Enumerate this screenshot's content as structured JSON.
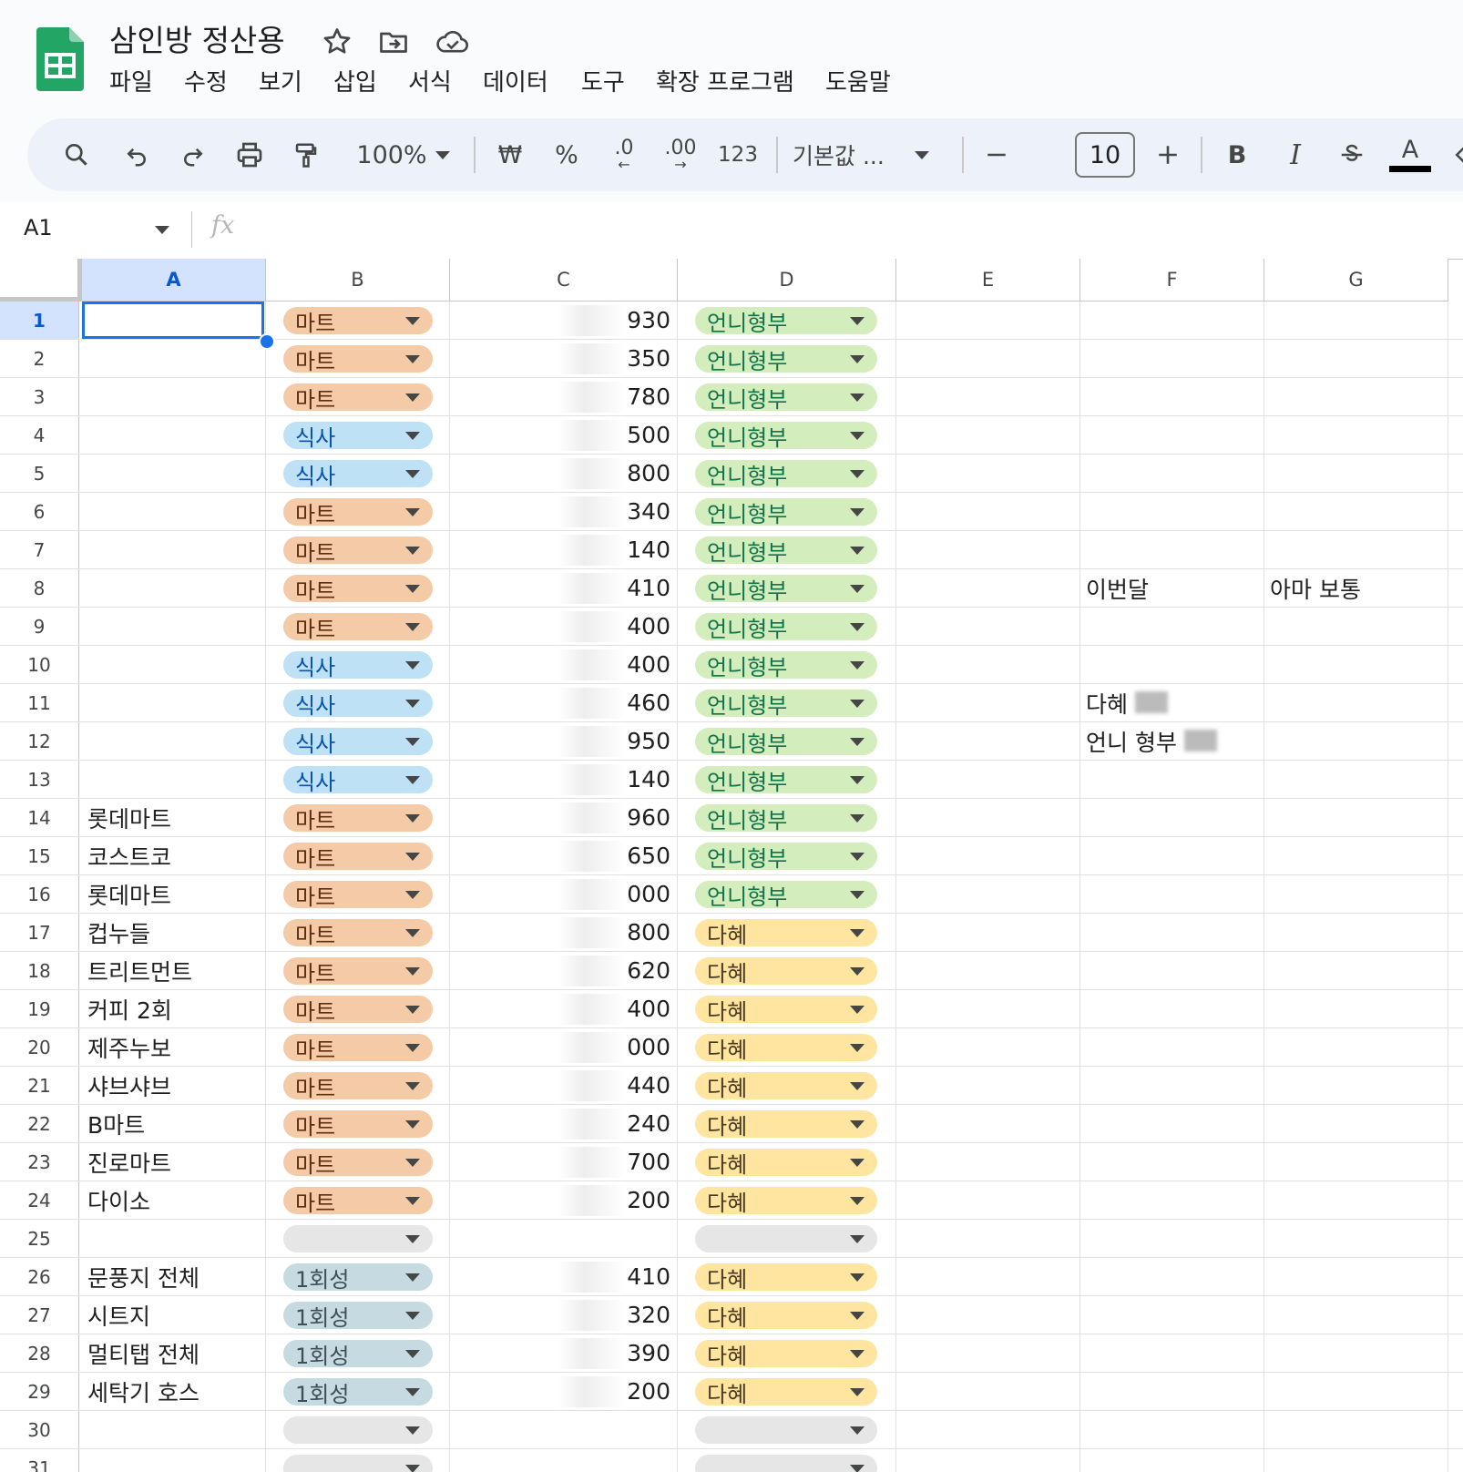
{
  "document": {
    "title": "삼인방 정산용"
  },
  "menu": [
    "파일",
    "수정",
    "보기",
    "삽입",
    "서식",
    "데이터",
    "도구",
    "확장 프로그램",
    "도움말"
  ],
  "toolbar": {
    "zoom": "100%",
    "currency": "₩",
    "percent": "%",
    "dec_decrease": ".0",
    "dec_increase": ".00",
    "number_format": "123",
    "font": "기본값 ...",
    "font_size": "10",
    "bold": "B",
    "italic": "I",
    "text_color": "A"
  },
  "formula_bar": {
    "name_box": "A1",
    "fx": "fx"
  },
  "columns": [
    "A",
    "B",
    "C",
    "D",
    "E",
    "F",
    "G"
  ],
  "chip_colors": {
    "마트": {
      "bg": "#f5cba7",
      "fg": "#5e2e0e"
    },
    "식사": {
      "bg": "#bfe1f6",
      "fg": "#0a53a8"
    },
    "1회성": {
      "bg": "#c6dbe1",
      "fg": "#3d4f58"
    },
    "언니형부": {
      "bg": "#d4edbc",
      "fg": "#11734b"
    },
    "다혜": {
      "bg": "#ffe5a0",
      "fg": "#473821"
    },
    "empty": {
      "bg": "#e6e6e6",
      "fg": "#444746"
    }
  },
  "rows": [
    {
      "n": 1,
      "a": "",
      "b": "마트",
      "c": "930",
      "d": "언니형부"
    },
    {
      "n": 2,
      "a": "",
      "b": "마트",
      "c": "350",
      "d": "언니형부"
    },
    {
      "n": 3,
      "a": "",
      "b": "마트",
      "c": "780",
      "d": "언니형부"
    },
    {
      "n": 4,
      "a": "",
      "b": "식사",
      "c": "500",
      "d": "언니형부"
    },
    {
      "n": 5,
      "a": "",
      "b": "식사",
      "c": "800",
      "d": "언니형부"
    },
    {
      "n": 6,
      "a": "",
      "b": "마트",
      "c": "340",
      "d": "언니형부"
    },
    {
      "n": 7,
      "a": "",
      "b": "마트",
      "c": "140",
      "d": "언니형부"
    },
    {
      "n": 8,
      "a": "",
      "b": "마트",
      "c": "410",
      "d": "언니형부",
      "f": "이번달",
      "g": "아마 보통"
    },
    {
      "n": 9,
      "a": "",
      "b": "마트",
      "c": "400",
      "d": "언니형부"
    },
    {
      "n": 10,
      "a": "",
      "b": "식사",
      "c": "400",
      "d": "언니형부"
    },
    {
      "n": 11,
      "a": "",
      "b": "식사",
      "c": "460",
      "d": "언니형부",
      "f": "다혜",
      "f_redacted": true
    },
    {
      "n": 12,
      "a": "",
      "b": "식사",
      "c": "950",
      "d": "언니형부",
      "f": "언니 형부",
      "f_redacted": true
    },
    {
      "n": 13,
      "a": "",
      "b": "식사",
      "c": "140",
      "d": "언니형부"
    },
    {
      "n": 14,
      "a": "롯데마트",
      "b": "마트",
      "c": "960",
      "d": "언니형부"
    },
    {
      "n": 15,
      "a": "코스트코",
      "b": "마트",
      "c": "650",
      "d": "언니형부"
    },
    {
      "n": 16,
      "a": "롯데마트",
      "b": "마트",
      "c": "000",
      "d": "언니형부"
    },
    {
      "n": 17,
      "a": "컵누들",
      "b": "마트",
      "c": "800",
      "d": "다혜"
    },
    {
      "n": 18,
      "a": "트리트먼트",
      "b": "마트",
      "c": "620",
      "d": "다혜"
    },
    {
      "n": 19,
      "a": "커피 2회",
      "b": "마트",
      "c": "400",
      "d": "다혜"
    },
    {
      "n": 20,
      "a": "제주누보",
      "b": "마트",
      "c": "000",
      "d": "다혜"
    },
    {
      "n": 21,
      "a": "샤브샤브",
      "b": "마트",
      "c": "440",
      "d": "다혜"
    },
    {
      "n": 22,
      "a": "B마트",
      "b": "마트",
      "c": "240",
      "d": "다혜"
    },
    {
      "n": 23,
      "a": "진로마트",
      "b": "마트",
      "c": "700",
      "d": "다혜"
    },
    {
      "n": 24,
      "a": "다이소",
      "b": "마트",
      "c": "200",
      "d": "다혜"
    },
    {
      "n": 25,
      "a": "",
      "b": "",
      "c": "",
      "d": ""
    },
    {
      "n": 26,
      "a": "문풍지 전체",
      "b": "1회성",
      "c": "410",
      "d": "다혜"
    },
    {
      "n": 27,
      "a": "시트지",
      "b": "1회성",
      "c": "320",
      "d": "다혜"
    },
    {
      "n": 28,
      "a": "멀티탭 전체",
      "b": "1회성",
      "c": "390",
      "d": "다혜"
    },
    {
      "n": 29,
      "a": "세탁기 호스",
      "b": "1회성",
      "c": "200",
      "d": "다혜"
    },
    {
      "n": 30,
      "a": "",
      "b": "",
      "c": "",
      "d": ""
    },
    {
      "n": 31,
      "a": "",
      "b": "",
      "c": "",
      "d": ""
    }
  ]
}
